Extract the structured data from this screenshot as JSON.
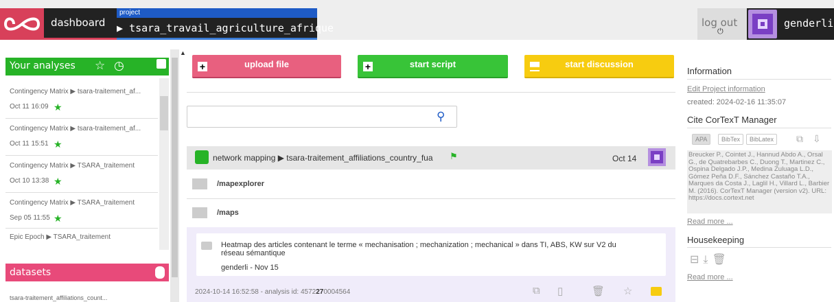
{
  "header": {
    "dashboard_label": "dashboard",
    "project_tag": "project",
    "project_name": "tsara_travail_agriculture_afrique",
    "logout_label": "log out",
    "user_name": "genderli"
  },
  "sidebar": {
    "analyses_title": "Your analyses",
    "analyses": [
      {
        "title": "Contingency Matrix ▶ tsara-traitement_af...",
        "date": "Oct 11 16:09"
      },
      {
        "title": "Contingency Matrix ▶ tsara-traitement_af...",
        "date": "Oct 11 15:51"
      },
      {
        "title": "Contingency Matrix ▶ TSARA_traitement",
        "date": "Oct 10 13:38"
      },
      {
        "title": "Contingency Matrix ▶ TSARA_traitement",
        "date": "Sep 05 11:55"
      },
      {
        "title": "Epic Epoch ▶ TSARA_traitement",
        "date": ""
      }
    ],
    "datasets_title": "datasets",
    "dataset_item": "tsara-traitement_affiliations_count..."
  },
  "main": {
    "upload_label": "upload file",
    "script_label": "start script",
    "discussion_label": "start discussion",
    "search_value": "",
    "result": {
      "title": "network mapping ▶ tsara-traitement_affiliations_country_fua",
      "date": "Oct 14",
      "folders": [
        "/mapexplorer",
        "/maps"
      ],
      "comment_text": "Heatmap des articles contenant le terme « mechanisation ; mechanization ; mechanical » dans TI, ABS, KW sur V2 du réseau sémantique",
      "comment_meta": "genderli -  Nov 15",
      "footer_meta": "2024-10-14 16:52:58 - analysis id: 4572",
      "footer_id_bold": "27",
      "footer_id_rest": "0004564"
    }
  },
  "info": {
    "title": "Information",
    "edit_link": "Edit Project information",
    "created": "created: 2024-02-16 11:35:07",
    "cite_title": "Cite CorTexT Manager",
    "cite_formats": [
      "APA",
      "BibTex",
      "BibLatex"
    ],
    "cite_text": "Breucker P., Cointet J., Hannud Abdo A., Orsal G., de Quatrebarbes C., Duong T., Martinez C., Ospina Delgado J.P., Medina Zuluaga L.D., Gómez Peña D.F., Sánchez Castaño T.A., Marques da Costa J., Laglil H., Villard L., Barbier M. (2016). CorTexT Manager (version v2). URL: https://docs.cortext.net",
    "read_more": "Read more ...",
    "housekeeping_title": "Housekeeping",
    "read_more_2": "Read more ..."
  },
  "colors": {
    "green": "#27b327",
    "pink": "#e8607f",
    "yellow": "#f7cc10",
    "blue": "#1e5bc6"
  }
}
